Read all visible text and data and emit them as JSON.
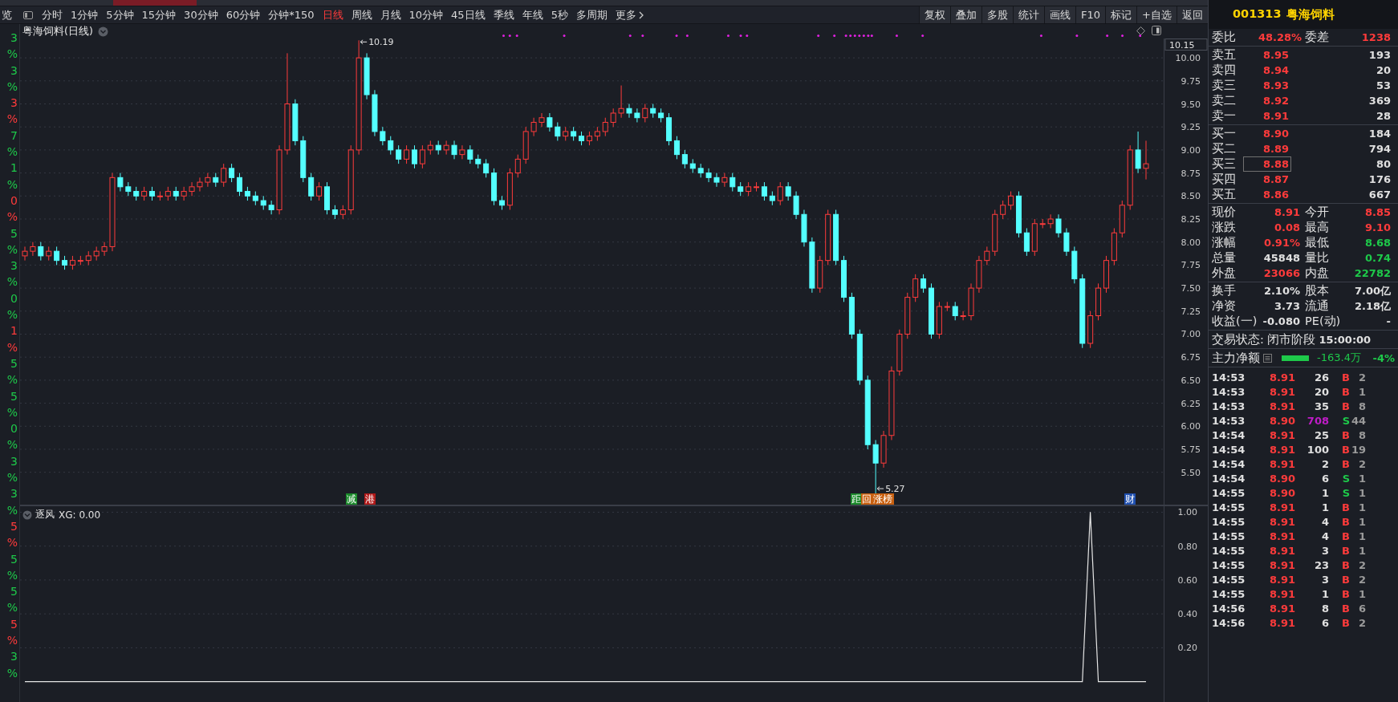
{
  "edge_column": [
    {
      "text": "3",
      "color": "#1ec94a"
    },
    {
      "text": "%",
      "color": "#1ec94a"
    },
    {
      "text": "3",
      "color": "#1ec94a"
    },
    {
      "text": "%",
      "color": "#1ec94a"
    },
    {
      "text": "3",
      "color": "#ff3b3b"
    },
    {
      "text": "%",
      "color": "#ff3b3b"
    },
    {
      "text": "7",
      "color": "#1ec94a"
    },
    {
      "text": "%",
      "color": "#1ec94a"
    },
    {
      "text": "1",
      "color": "#1ec94a"
    },
    {
      "text": "%",
      "color": "#1ec94a"
    },
    {
      "text": "0",
      "color": "#ff3b3b"
    },
    {
      "text": "%",
      "color": "#ff3b3b"
    },
    {
      "text": "5",
      "color": "#1ec94a"
    },
    {
      "text": "%",
      "color": "#1ec94a"
    },
    {
      "text": "3",
      "color": "#1ec94a"
    },
    {
      "text": "%",
      "color": "#1ec94a"
    },
    {
      "text": "0",
      "color": "#1ec94a"
    },
    {
      "text": "%",
      "color": "#1ec94a"
    },
    {
      "text": "1",
      "color": "#ff3b3b"
    },
    {
      "text": "%",
      "color": "#ff3b3b"
    },
    {
      "text": "5",
      "color": "#1ec94a"
    },
    {
      "text": "%",
      "color": "#1ec94a"
    },
    {
      "text": "5",
      "color": "#1ec94a"
    },
    {
      "text": "%",
      "color": "#1ec94a"
    },
    {
      "text": "0",
      "color": "#1ec94a"
    },
    {
      "text": "%",
      "color": "#1ec94a"
    },
    {
      "text": "3",
      "color": "#1ec94a"
    },
    {
      "text": "%",
      "color": "#1ec94a"
    },
    {
      "text": "3",
      "color": "#1ec94a"
    },
    {
      "text": "%",
      "color": "#1ec94a"
    },
    {
      "text": "5",
      "color": "#ff3b3b"
    },
    {
      "text": "%",
      "color": "#ff3b3b"
    },
    {
      "text": "5",
      "color": "#1ec94a"
    },
    {
      "text": "%",
      "color": "#1ec94a"
    },
    {
      "text": "5",
      "color": "#1ec94a"
    },
    {
      "text": "%",
      "color": "#1ec94a"
    },
    {
      "text": "5",
      "color": "#ff3b3b"
    },
    {
      "text": "%",
      "color": "#ff3b3b"
    },
    {
      "text": "3",
      "color": "#1ec94a"
    },
    {
      "text": "%",
      "color": "#1ec94a"
    }
  ],
  "toolbar": {
    "edge_text": "览",
    "periods": [
      {
        "label": "分时",
        "selected": false
      },
      {
        "label": "1分钟",
        "selected": false
      },
      {
        "label": "5分钟",
        "selected": false
      },
      {
        "label": "15分钟",
        "selected": false
      },
      {
        "label": "30分钟",
        "selected": false
      },
      {
        "label": "60分钟",
        "selected": false
      },
      {
        "label": "分钟*150",
        "selected": false
      },
      {
        "label": "日线",
        "selected": true
      },
      {
        "label": "周线",
        "selected": false
      },
      {
        "label": "月线",
        "selected": false
      },
      {
        "label": "10分钟",
        "selected": false
      },
      {
        "label": "45日线",
        "selected": false
      },
      {
        "label": "季线",
        "selected": false
      },
      {
        "label": "年线",
        "selected": false
      },
      {
        "label": "5秒",
        "selected": false
      },
      {
        "label": "多周期",
        "selected": false
      },
      {
        "label": "更多",
        "selected": false
      }
    ],
    "actions": [
      "复权",
      "叠加",
      "多股",
      "统计",
      "画线",
      "F10",
      "标记",
      "+自选",
      "返回"
    ]
  },
  "chart": {
    "title": "粤海饲料(日线)",
    "current_tick": "10.15",
    "high_label": "10.19",
    "low_label": "5.27",
    "chart_data": {
      "type": "candlestick",
      "grid": true,
      "ylim": [
        5.14,
        10.21
      ],
      "yticks": [
        {
          "value": 10,
          "label": "10.00"
        },
        {
          "value": 9.75,
          "label": "9.75"
        },
        {
          "value": 9.5,
          "label": "9.50"
        },
        {
          "value": 9.25,
          "label": "9.25"
        },
        {
          "value": 9,
          "label": "9.00"
        },
        {
          "value": 8.75,
          "label": "8.75"
        },
        {
          "value": 8.5,
          "label": "8.50"
        },
        {
          "value": 8.25,
          "label": "8.25"
        },
        {
          "value": 8,
          "label": "8.00"
        },
        {
          "value": 7.75,
          "label": "7.75"
        },
        {
          "value": 7.5,
          "label": "7.50"
        },
        {
          "value": 7.25,
          "label": "7.25"
        },
        {
          "value": 7,
          "label": "7.00"
        },
        {
          "value": 6.75,
          "label": "6.75"
        },
        {
          "value": 6.5,
          "label": "6.50"
        },
        {
          "value": 6.25,
          "label": "6.25"
        },
        {
          "value": 6,
          "label": "6.00"
        },
        {
          "value": 5.75,
          "label": "5.75"
        },
        {
          "value": 5.5,
          "label": "5.50"
        }
      ],
      "ohlc": [
        [
          7.85,
          7.95,
          7.8,
          7.9
        ],
        [
          7.9,
          8.0,
          7.85,
          7.95
        ],
        [
          7.95,
          8.0,
          7.8,
          7.85
        ],
        [
          7.85,
          7.95,
          7.8,
          7.9
        ],
        [
          7.9,
          7.95,
          7.75,
          7.8
        ],
        [
          7.8,
          7.85,
          7.7,
          7.75
        ],
        [
          7.75,
          7.85,
          7.7,
          7.8
        ],
        [
          7.8,
          7.85,
          7.75,
          7.8
        ],
        [
          7.8,
          7.9,
          7.75,
          7.85
        ],
        [
          7.85,
          7.95,
          7.8,
          7.9
        ],
        [
          7.9,
          8.0,
          7.85,
          7.95
        ],
        [
          7.95,
          8.75,
          7.9,
          8.7
        ],
        [
          8.7,
          8.75,
          8.55,
          8.6
        ],
        [
          8.6,
          8.65,
          8.5,
          8.55
        ],
        [
          8.55,
          8.6,
          8.45,
          8.5
        ],
        [
          8.5,
          8.6,
          8.45,
          8.55
        ],
        [
          8.55,
          8.6,
          8.45,
          8.5
        ],
        [
          8.5,
          8.55,
          8.45,
          8.5
        ],
        [
          8.5,
          8.6,
          8.45,
          8.55
        ],
        [
          8.55,
          8.6,
          8.45,
          8.5
        ],
        [
          8.5,
          8.6,
          8.45,
          8.55
        ],
        [
          8.55,
          8.65,
          8.5,
          8.6
        ],
        [
          8.6,
          8.7,
          8.55,
          8.65
        ],
        [
          8.65,
          8.75,
          8.6,
          8.7
        ],
        [
          8.7,
          8.75,
          8.6,
          8.65
        ],
        [
          8.65,
          8.85,
          8.6,
          8.8
        ],
        [
          8.8,
          8.85,
          8.65,
          8.7
        ],
        [
          8.7,
          8.75,
          8.5,
          8.55
        ],
        [
          8.55,
          8.6,
          8.45,
          8.5
        ],
        [
          8.5,
          8.55,
          8.4,
          8.45
        ],
        [
          8.45,
          8.5,
          8.35,
          8.4
        ],
        [
          8.4,
          8.45,
          8.3,
          8.35
        ],
        [
          8.35,
          9.05,
          8.3,
          9.0
        ],
        [
          9.0,
          10.05,
          8.95,
          9.5
        ],
        [
          9.5,
          9.55,
          9.05,
          9.1
        ],
        [
          9.1,
          9.15,
          8.65,
          8.7
        ],
        [
          8.7,
          8.75,
          8.45,
          8.5
        ],
        [
          8.5,
          8.65,
          8.45,
          8.6
        ],
        [
          8.6,
          8.65,
          8.3,
          8.35
        ],
        [
          8.35,
          8.4,
          8.25,
          8.3
        ],
        [
          8.3,
          8.4,
          8.25,
          8.35
        ],
        [
          8.35,
          9.05,
          8.3,
          9.0
        ],
        [
          9.0,
          10.19,
          8.95,
          10.0
        ],
        [
          10.0,
          10.05,
          9.55,
          9.6
        ],
        [
          9.6,
          9.65,
          9.15,
          9.2
        ],
        [
          9.2,
          9.25,
          9.05,
          9.1
        ],
        [
          9.1,
          9.15,
          8.95,
          9.0
        ],
        [
          9.0,
          9.05,
          8.85,
          8.9
        ],
        [
          8.9,
          9.05,
          8.85,
          9.0
        ],
        [
          9.0,
          9.05,
          8.8,
          8.85
        ],
        [
          8.85,
          9.05,
          8.8,
          9.0
        ],
        [
          9.0,
          9.1,
          8.95,
          9.05
        ],
        [
          9.05,
          9.1,
          8.95,
          9.0
        ],
        [
          9.0,
          9.1,
          8.95,
          9.05
        ],
        [
          9.05,
          9.1,
          8.9,
          8.95
        ],
        [
          8.95,
          9.05,
          8.9,
          9.0
        ],
        [
          9.0,
          9.05,
          8.85,
          8.9
        ],
        [
          8.9,
          8.95,
          8.8,
          8.85
        ],
        [
          8.85,
          8.9,
          8.7,
          8.75
        ],
        [
          8.75,
          8.8,
          8.4,
          8.45
        ],
        [
          8.45,
          8.5,
          8.35,
          8.4
        ],
        [
          8.4,
          8.8,
          8.35,
          8.75
        ],
        [
          8.75,
          8.95,
          8.7,
          8.9
        ],
        [
          8.9,
          9.25,
          8.85,
          9.2
        ],
        [
          9.2,
          9.35,
          9.15,
          9.3
        ],
        [
          9.3,
          9.4,
          9.25,
          9.35
        ],
        [
          9.35,
          9.4,
          9.2,
          9.25
        ],
        [
          9.25,
          9.3,
          9.1,
          9.15
        ],
        [
          9.15,
          9.25,
          9.1,
          9.2
        ],
        [
          9.2,
          9.25,
          9.1,
          9.15
        ],
        [
          9.15,
          9.2,
          9.05,
          9.1
        ],
        [
          9.1,
          9.2,
          9.05,
          9.15
        ],
        [
          9.15,
          9.25,
          9.1,
          9.2
        ],
        [
          9.2,
          9.35,
          9.15,
          9.3
        ],
        [
          9.3,
          9.45,
          9.25,
          9.4
        ],
        [
          9.4,
          9.7,
          9.35,
          9.45
        ],
        [
          9.45,
          9.5,
          9.35,
          9.4
        ],
        [
          9.4,
          9.45,
          9.3,
          9.35
        ],
        [
          9.35,
          9.5,
          9.3,
          9.45
        ],
        [
          9.45,
          9.5,
          9.35,
          9.4
        ],
        [
          9.4,
          9.45,
          9.3,
          9.35
        ],
        [
          9.35,
          9.4,
          9.05,
          9.1
        ],
        [
          9.1,
          9.15,
          8.9,
          8.95
        ],
        [
          8.95,
          9.0,
          8.8,
          8.85
        ],
        [
          8.85,
          8.9,
          8.75,
          8.8
        ],
        [
          8.8,
          8.85,
          8.7,
          8.75
        ],
        [
          8.75,
          8.8,
          8.65,
          8.7
        ],
        [
          8.7,
          8.75,
          8.6,
          8.65
        ],
        [
          8.65,
          8.75,
          8.6,
          8.7
        ],
        [
          8.7,
          8.75,
          8.55,
          8.6
        ],
        [
          8.6,
          8.65,
          8.5,
          8.55
        ],
        [
          8.55,
          8.65,
          8.5,
          8.6
        ],
        [
          8.6,
          8.65,
          8.55,
          8.6
        ],
        [
          8.6,
          8.65,
          8.45,
          8.5
        ],
        [
          8.5,
          8.55,
          8.4,
          8.45
        ],
        [
          8.45,
          8.65,
          8.4,
          8.6
        ],
        [
          8.6,
          8.65,
          8.45,
          8.5
        ],
        [
          8.5,
          8.55,
          8.25,
          8.3
        ],
        [
          8.3,
          8.35,
          7.95,
          8.0
        ],
        [
          8.0,
          8.05,
          7.45,
          7.5
        ],
        [
          7.5,
          7.85,
          7.45,
          7.8
        ],
        [
          7.8,
          8.35,
          7.75,
          8.3
        ],
        [
          8.3,
          8.35,
          7.75,
          7.8
        ],
        [
          7.8,
          7.85,
          7.35,
          7.4
        ],
        [
          7.4,
          7.45,
          6.95,
          7.0
        ],
        [
          7.0,
          7.05,
          6.45,
          6.5
        ],
        [
          6.5,
          6.55,
          5.75,
          5.8
        ],
        [
          5.8,
          5.85,
          5.27,
          5.6
        ],
        [
          5.6,
          5.95,
          5.55,
          5.9
        ],
        [
          5.9,
          6.65,
          5.85,
          6.6
        ],
        [
          6.6,
          7.05,
          6.55,
          7.0
        ],
        [
          7.0,
          7.45,
          6.95,
          7.4
        ],
        [
          7.4,
          7.65,
          7.35,
          7.6
        ],
        [
          7.6,
          7.65,
          7.45,
          7.5
        ],
        [
          7.5,
          7.55,
          6.95,
          7.0
        ],
        [
          7.0,
          7.35,
          6.95,
          7.3
        ],
        [
          7.3,
          7.35,
          7.25,
          7.3
        ],
        [
          7.3,
          7.35,
          7.15,
          7.2
        ],
        [
          7.2,
          7.25,
          7.15,
          7.2
        ],
        [
          7.2,
          7.55,
          7.15,
          7.5
        ],
        [
          7.5,
          7.85,
          7.45,
          7.8
        ],
        [
          7.8,
          7.95,
          7.75,
          7.9
        ],
        [
          7.9,
          8.35,
          7.85,
          8.3
        ],
        [
          8.3,
          8.45,
          8.25,
          8.4
        ],
        [
          8.4,
          8.55,
          8.35,
          8.5
        ],
        [
          8.5,
          8.55,
          8.05,
          8.1
        ],
        [
          8.1,
          8.15,
          7.85,
          7.9
        ],
        [
          7.9,
          8.25,
          7.85,
          8.2
        ],
        [
          8.2,
          8.25,
          8.15,
          8.2
        ],
        [
          8.2,
          8.3,
          8.15,
          8.25
        ],
        [
          8.25,
          8.3,
          8.05,
          8.1
        ],
        [
          8.1,
          8.15,
          7.85,
          7.9
        ],
        [
          7.9,
          7.95,
          7.55,
          7.6
        ],
        [
          7.6,
          7.65,
          6.85,
          6.9
        ],
        [
          6.9,
          7.25,
          6.85,
          7.2
        ],
        [
          7.2,
          7.55,
          7.15,
          7.5
        ],
        [
          7.5,
          7.85,
          7.45,
          7.8
        ],
        [
          7.8,
          8.15,
          7.75,
          8.1
        ],
        [
          8.1,
          8.45,
          8.05,
          8.4
        ],
        [
          8.4,
          9.05,
          8.35,
          9.0
        ],
        [
          9.0,
          9.2,
          8.75,
          8.8
        ],
        [
          8.8,
          9.1,
          8.68,
          8.85
        ]
      ]
    },
    "marks": [
      {
        "text": "减",
        "color": "#1a8a2a"
      },
      {
        "text": "港",
        "color": "#b01818"
      },
      {
        "text": "距",
        "color": "#1a8a2a"
      },
      {
        "text": "回",
        "color": "#c86010"
      },
      {
        "text": "涨榜",
        "color": "#c86010"
      },
      {
        "text": "财",
        "color": "#2050b0"
      }
    ]
  },
  "indicator": {
    "name": "逐风",
    "value_label": ": 0.00",
    "chart_data": {
      "type": "line",
      "grid": true,
      "ylim": [
        -0.12,
        1.04
      ],
      "yticks": [
        {
          "value": 1,
          "label": "1.00"
        },
        {
          "value": 0.8,
          "label": "0.80"
        },
        {
          "value": 0.6,
          "label": "0.60"
        },
        {
          "value": 0.4,
          "label": "0.40"
        },
        {
          "value": 0.2,
          "label": "0.20"
        }
      ],
      "series": [
        {
          "name": "XG",
          "color": "#e6e6e6",
          "values": [
            0,
            0,
            0,
            0,
            0,
            0,
            0,
            0,
            0,
            0,
            0,
            0,
            0,
            0,
            0,
            0,
            0,
            0,
            0,
            0,
            0,
            0,
            0,
            0,
            0,
            0,
            0,
            0,
            0,
            0,
            0,
            0,
            0,
            0,
            0,
            0,
            0,
            0,
            0,
            0,
            0,
            0,
            0,
            0,
            0,
            0,
            0,
            0,
            0,
            0,
            0,
            0,
            0,
            0,
            0,
            0,
            0,
            0,
            0,
            0,
            0,
            0,
            0,
            0,
            0,
            0,
            0,
            0,
            0,
            0,
            0,
            0,
            0,
            0,
            0,
            0,
            0,
            0,
            0,
            0,
            0,
            0,
            0,
            0,
            0,
            0,
            0,
            0,
            0,
            0,
            0,
            0,
            0,
            0,
            0,
            0,
            0,
            0,
            0,
            0,
            0,
            0,
            0,
            0,
            0,
            0,
            0,
            0,
            0,
            0,
            0,
            0,
            0,
            0,
            0,
            0,
            0,
            0,
            0,
            0,
            0,
            0,
            0,
            0,
            0,
            0,
            0,
            0,
            0,
            0,
            0,
            0,
            0,
            0,
            1,
            0,
            0,
            0,
            0,
            0,
            0,
            0
          ]
        }
      ]
    }
  },
  "quote": {
    "code": "001313",
    "name": "粤海饲料",
    "ratio": [
      {
        "label": "委比",
        "value": "48.28%",
        "color": "#ff3b3b"
      },
      {
        "label": "委差",
        "value": "1238",
        "color": "#ff3b3b"
      }
    ],
    "sells": [
      {
        "label": "卖五",
        "price": "8.95",
        "volume": "193"
      },
      {
        "label": "卖四",
        "price": "8.94",
        "volume": "20"
      },
      {
        "label": "卖三",
        "price": "8.93",
        "volume": "53"
      },
      {
        "label": "卖二",
        "price": "8.92",
        "volume": "369"
      },
      {
        "label": "卖一",
        "price": "8.91",
        "volume": "28"
      }
    ],
    "buys": [
      {
        "label": "买一",
        "price": "8.90",
        "volume": "184",
        "selected": false
      },
      {
        "label": "买二",
        "price": "8.89",
        "volume": "794",
        "selected": false
      },
      {
        "label": "买三",
        "price": "8.88",
        "volume": "80",
        "selected": true
      },
      {
        "label": "买四",
        "price": "8.87",
        "volume": "176",
        "selected": false
      },
      {
        "label": "买五",
        "price": "8.86",
        "volume": "667",
        "selected": false
      }
    ],
    "stats": [
      {
        "label": "现价",
        "value": "8.91",
        "color": "#ff3b3b"
      },
      {
        "label": "今开",
        "value": "8.85",
        "color": "#ff3b3b"
      },
      {
        "label": "涨跌",
        "value": "0.08",
        "color": "#ff3b3b"
      },
      {
        "label": "最高",
        "value": "9.10",
        "color": "#ff3b3b"
      },
      {
        "label": "涨幅",
        "value": "0.91%",
        "color": "#ff3b3b"
      },
      {
        "label": "最低",
        "value": "8.68",
        "color": "#1ec94a"
      },
      {
        "label": "总量",
        "value": "45848",
        "color": "#e0e0e0"
      },
      {
        "label": "量比",
        "value": "0.74",
        "color": "#1ec94a"
      },
      {
        "label": "外盘",
        "value": "23066",
        "color": "#ff3b3b"
      },
      {
        "label": "内盘",
        "value": "22782",
        "color": "#1ec94a"
      }
    ],
    "fundamentals": [
      {
        "label": "换手",
        "value": "2.10%"
      },
      {
        "label": "股本",
        "value": "7.00亿"
      },
      {
        "label": "净资",
        "value": "3.73"
      },
      {
        "label": "流通",
        "value": "2.18亿"
      },
      {
        "label": "收益(一)",
        "value": "-0.080"
      },
      {
        "label": "PE(动)",
        "value": "-"
      }
    ],
    "status_label": "交易状态: 闭市阶段",
    "status_time": "15:00:00",
    "net_flow": {
      "label": "主力净额",
      "amount": "-163.4万",
      "percent": "-4%"
    },
    "trades": [
      {
        "time": "14:53",
        "price": "8.91",
        "volume": "26",
        "large": false,
        "side": "B",
        "buy": true,
        "count": "2"
      },
      {
        "time": "14:53",
        "price": "8.91",
        "volume": "20",
        "large": false,
        "side": "B",
        "buy": true,
        "count": "1"
      },
      {
        "time": "14:53",
        "price": "8.91",
        "volume": "35",
        "large": false,
        "side": "B",
        "buy": true,
        "count": "8"
      },
      {
        "time": "14:53",
        "price": "8.90",
        "volume": "708",
        "large": true,
        "side": "S",
        "buy": false,
        "count": "44"
      },
      {
        "time": "14:54",
        "price": "8.91",
        "volume": "25",
        "large": false,
        "side": "B",
        "buy": true,
        "count": "8"
      },
      {
        "time": "14:54",
        "price": "8.91",
        "volume": "100",
        "large": false,
        "side": "B",
        "buy": true,
        "count": "19"
      },
      {
        "time": "14:54",
        "price": "8.91",
        "volume": "2",
        "large": false,
        "side": "B",
        "buy": true,
        "count": "2"
      },
      {
        "time": "14:54",
        "price": "8.90",
        "volume": "6",
        "large": false,
        "side": "S",
        "buy": false,
        "count": "1"
      },
      {
        "time": "14:55",
        "price": "8.90",
        "volume": "1",
        "large": false,
        "side": "S",
        "buy": false,
        "count": "1"
      },
      {
        "time": "14:55",
        "price": "8.91",
        "volume": "1",
        "large": false,
        "side": "B",
        "buy": true,
        "count": "1"
      },
      {
        "time": "14:55",
        "price": "8.91",
        "volume": "4",
        "large": false,
        "side": "B",
        "buy": true,
        "count": "1"
      },
      {
        "time": "14:55",
        "price": "8.91",
        "volume": "4",
        "large": false,
        "side": "B",
        "buy": true,
        "count": "1"
      },
      {
        "time": "14:55",
        "price": "8.91",
        "volume": "3",
        "large": false,
        "side": "B",
        "buy": true,
        "count": "1"
      },
      {
        "time": "14:55",
        "price": "8.91",
        "volume": "23",
        "large": false,
        "side": "B",
        "buy": true,
        "count": "2"
      },
      {
        "time": "14:55",
        "price": "8.91",
        "volume": "3",
        "large": false,
        "side": "B",
        "buy": true,
        "count": "2"
      },
      {
        "time": "14:55",
        "price": "8.91",
        "volume": "1",
        "large": false,
        "side": "B",
        "buy": true,
        "count": "1"
      },
      {
        "time": "14:56",
        "price": "8.91",
        "volume": "8",
        "large": false,
        "side": "B",
        "buy": true,
        "count": "6"
      },
      {
        "time": "14:56",
        "price": "8.91",
        "volume": "6",
        "large": false,
        "side": "B",
        "buy": true,
        "count": "2"
      }
    ]
  }
}
